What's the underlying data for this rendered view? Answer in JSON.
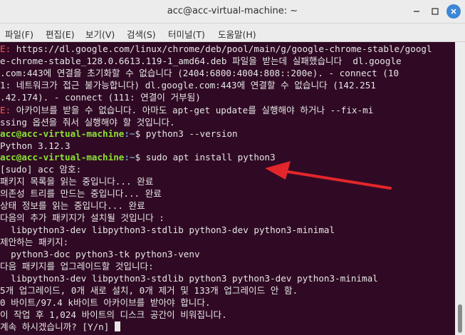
{
  "window": {
    "title": "acc@acc-virtual-machine: ~"
  },
  "menu": {
    "file": "파일(F)",
    "edit": "편집(E)",
    "view": "보기(V)",
    "search": "검색(S)",
    "terminal": "터미널(T)",
    "help": "도움말(H)"
  },
  "terminal": {
    "l1_err": "E:",
    "l1_text": " https://dl.google.com/linux/chrome/deb/pool/main/g/google-chrome-stable/googl",
    "l2": "e-chrome-stable_128.0.6613.119-1_amd64.deb 파일을 받는데 실패했습니다  dl.google",
    "l3": ".com:443에 연결을 초기화할 수 없습니다 (2404:6800:4004:808::200e). - connect (10",
    "l4": "1: 네트워크가 접근 불가능합니다) dl.google.com:443에 연결할 수 없습니다 (142.251",
    "l5": ".42.174). - connect (111: 연결이 거부됨)",
    "l6_err": "E:",
    "l6_text": " 아카이브를 받을 수 없습니다. 아마도 apt-get update를 실행해야 하거나 --fix-mi",
    "l7": "ssing 옵션을 줘서 실행해야 할 것입니다.",
    "prompt_user": "acc@acc-virtual-machine",
    "prompt_path": ":~",
    "prompt_sign": "$ ",
    "cmd1": "python3 --version",
    "l9": "Python 3.12.3",
    "cmd2": "sudo apt install python3",
    "l11": "[sudo] acc 암호:",
    "l12": "패키지 목록을 읽는 중입니다... 완료",
    "l13": "의존성 트리를 만드는 중입니다... 완료",
    "l14": "상태 정보를 읽는 중입니다... 완료",
    "l15": "다음의 추가 패키지가 설치될 것입니다 :",
    "l16": "  libpython3-dev libpython3-stdlib python3-dev python3-minimal",
    "l17": "제안하는 패키지:",
    "l18": "  python3-doc python3-tk python3-venv",
    "l19": "다음 패키지를 업그레이드할 것입니다:",
    "l20": "  libpython3-dev libpython3-stdlib python3 python3-dev python3-minimal",
    "l21": "5개 업그레이드, 0개 새로 설치, 0개 제거 및 133개 업그레이드 안 함.",
    "l22": "0 바이트/97.4 k바이트 아카이브를 받아야 합니다.",
    "l23": "이 작업 후 1,024 바이트의 디스크 공간이 비워집니다.",
    "l24": "계속 하시겠습니까? [Y/n] "
  },
  "colors": {
    "terminal_bg": "#300a24",
    "prompt_user": "#8ae234",
    "prompt_path": "#729fcf",
    "error": "#ff5555",
    "annotation_arrow": "#e3262b"
  },
  "icons": [
    "minimize-icon",
    "maximize-icon",
    "close-icon",
    "arrow-annotation"
  ]
}
